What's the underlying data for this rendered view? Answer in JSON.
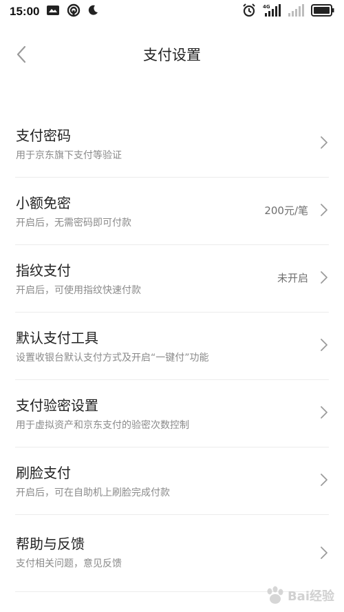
{
  "status_bar": {
    "time": "15:00",
    "signal_label": "4G"
  },
  "nav": {
    "title": "支付设置"
  },
  "rows": [
    {
      "title": "支付密码",
      "subtitle": "用于京东旗下支付等验证",
      "value": ""
    },
    {
      "title": "小额免密",
      "subtitle": "开启后，无需密码即可付款",
      "value": "200元/笔"
    },
    {
      "title": "指纹支付",
      "subtitle": "开启后，可使用指纹快速付款",
      "value": "未开启"
    },
    {
      "title": "默认支付工具",
      "subtitle": "设置收银台默认支付方式及开启“一键付”功能",
      "value": ""
    },
    {
      "title": "支付验密设置",
      "subtitle": "用于虚拟资产和京东支付的验密次数控制",
      "value": ""
    },
    {
      "title": "刷脸支付",
      "subtitle": "开启后，可在自助机上刷脸完成付款",
      "value": ""
    },
    {
      "title": "帮助与反馈",
      "subtitle": "支付相关问题，意见反馈",
      "value": ""
    }
  ],
  "watermark": {
    "text": "Bai经验"
  },
  "colors": {
    "text_primary": "#222222",
    "text_secondary": "#8a8a8a",
    "divider": "#ececec",
    "chevron": "#9a9a9a"
  }
}
